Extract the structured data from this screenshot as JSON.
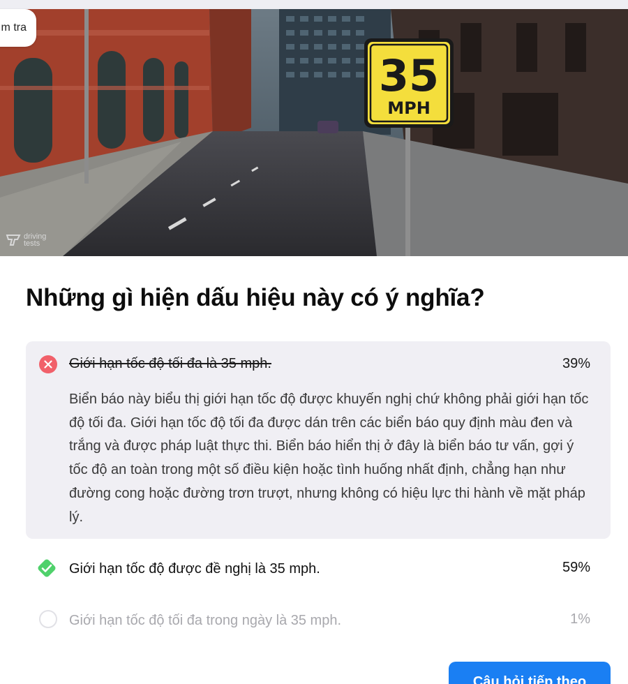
{
  "tab": {
    "label": "m tra"
  },
  "image": {
    "sign_number": "35",
    "sign_unit": "MPH",
    "watermark_line1": "driving",
    "watermark_line2": "tests"
  },
  "question": "Những gì hiện dấu hiệu này có ý nghĩa?",
  "answers": [
    {
      "label": "Giới hạn tốc độ tối đa là 35 mph.",
      "percent": "39%",
      "state": "incorrect",
      "explanation": "Biển báo này biểu thị giới hạn tốc độ được khuyến nghị chứ không phải giới hạn tốc độ tối đa. Giới hạn tốc độ tối đa được dán trên các biển báo quy định màu đen và trắng và được pháp luật thực thi. Biển báo hiển thị ở đây là biển báo tư vấn, gợi ý tốc độ an toàn trong một số điều kiện hoặc tình huống nhất định, chẳng hạn như đường cong hoặc đường trơn trượt, nhưng không có hiệu lực thi hành về mặt pháp lý."
    },
    {
      "label": "Giới hạn tốc độ được đề nghị là 35 mph.",
      "percent": "59%",
      "state": "correct"
    },
    {
      "label": "Giới hạn tốc độ tối đa trong ngày là 35 mph.",
      "percent": "1%",
      "state": "neutral"
    }
  ],
  "next_button": "Câu hỏi tiếp theo",
  "colors": {
    "accent": "#1a7ff3",
    "incorrect": "#f1606a",
    "correct": "#4fd16b",
    "sign_yellow": "#f4de3c"
  },
  "icons": {
    "incorrect": "close-circle-icon",
    "correct": "check-diamond-icon",
    "neutral": "empty-circle-icon"
  }
}
